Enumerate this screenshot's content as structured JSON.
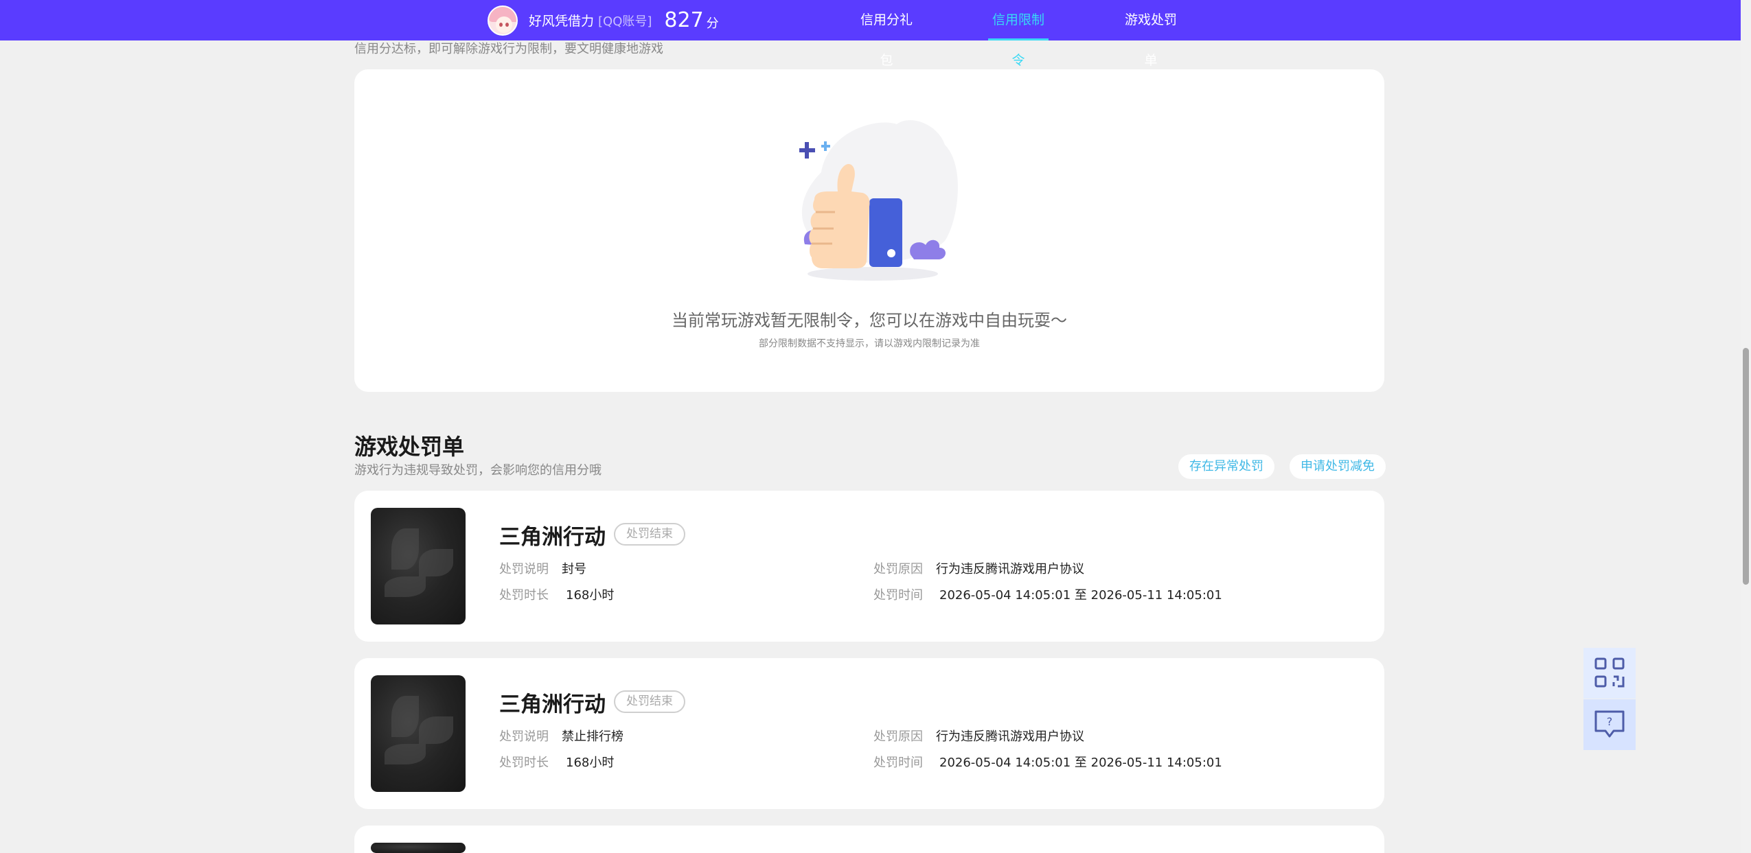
{
  "header": {
    "user_name": "好风凭借力",
    "account_type": "[QQ账号]",
    "score": "827",
    "score_unit": "分",
    "nav": [
      {
        "label": "信用分礼包"
      },
      {
        "label": "信用限制令"
      },
      {
        "label": "游戏处罚单"
      }
    ],
    "active_nav": "信用限制令"
  },
  "restriction": {
    "subtitle": "信用分达标，即可解除游戏行为限制，要文明健康地游戏",
    "empty_message": "当前常玩游戏暂无限制令，您可以在游戏中自由玩耍～",
    "empty_note": "部分限制数据不支持显示，请以游戏内限制记录为准"
  },
  "penalty": {
    "title": "游戏处罚单",
    "subtitle": "游戏行为违规导致处罚，会影响您的信用分哦",
    "btn_abnormal": "存在异常处罚",
    "btn_reduce": "申请处罚减免",
    "labels": {
      "desc": "处罚说明",
      "duration": "处罚时长",
      "reason": "处罚原因",
      "time": "处罚时间"
    },
    "items": [
      {
        "game": "三角洲行动",
        "status": "处罚结束",
        "desc": "封号",
        "duration": "168小时",
        "reason": "行为违反腾讯游戏用户协议",
        "time": "2026-05-04 14:05:01 至 2026-05-11 14:05:01"
      },
      {
        "game": "三角洲行动",
        "status": "处罚结束",
        "desc": "禁止排行榜",
        "duration": "168小时",
        "reason": "行为违反腾讯游戏用户协议",
        "time": "2026-05-04 14:05:01 至 2026-05-11 14:05:01"
      }
    ]
  },
  "side_buttons": {
    "qr_icon": "qr-code-icon",
    "feedback_icon": "help-chat-icon"
  },
  "colors": {
    "nav_bg": "#5a3cff",
    "accent": "#38d9f5",
    "link": "#3fb8e6"
  }
}
